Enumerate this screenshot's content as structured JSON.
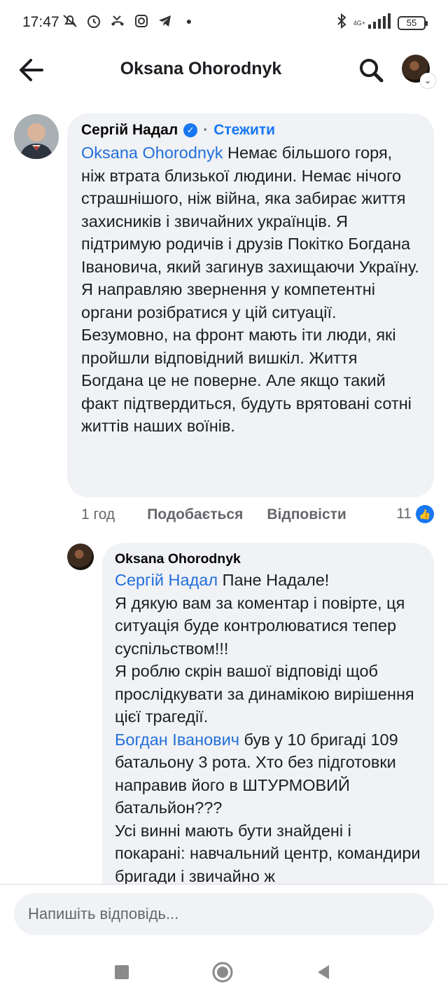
{
  "status_bar": {
    "time": "17:47",
    "network_label": "4G+",
    "battery": "55"
  },
  "header": {
    "title": "Oksana Ohorodnyk"
  },
  "comment_1": {
    "author": "Сергій Надал",
    "follow_label": "Стежити",
    "mention": "Oksana Ohorodnyk",
    "text": " Немає більшого горя, ніж втрата близької людини. Немає нічого страшнішого, ніж війна, яка забирає життя захисників і звичайних українців. Я підтримую родичів і друзів Покітко Богдана Івановича, який загинув захищаючи Україну. Я направляю звернення у компетентні органи розібратися у цій ситуації. Безумовно, на фронт мають іти люди, які пройшли відповідний вишкіл. Життя Богдана це не поверне. Але якщо такий факт підтвердиться, будуть врятовані сотні життів наших воїнів.",
    "time": "1 год",
    "like_label": "Подобається",
    "reply_label": "Відповісти",
    "reaction_count": "11"
  },
  "reply_1": {
    "author": "Oksana Ohorodnyk",
    "mention_1": "Сергій Надал",
    "text_1": " Пане Надале!",
    "text_2": "Я дякую вам за коментар і повірте, ця ситуація буде контролюватися тепер суспільством!!!",
    "text_3": "Я роблю скрін вашої відповіді щоб прослідкувати за динамікою вирішення цієї трагедії.",
    "mention_2": "Богдан Іванович",
    "text_4": "  був у 10 бригаді 109 батальону 3 рота. Хто без підготовки направив його в ШТУРМОВИЙ батальйон???",
    "text_5": "Усі винні мають бути знайдені і покарані: навчальний центр, командири бригади і звичайно ж"
  },
  "composer": {
    "placeholder": "Напишіть відповідь..."
  }
}
